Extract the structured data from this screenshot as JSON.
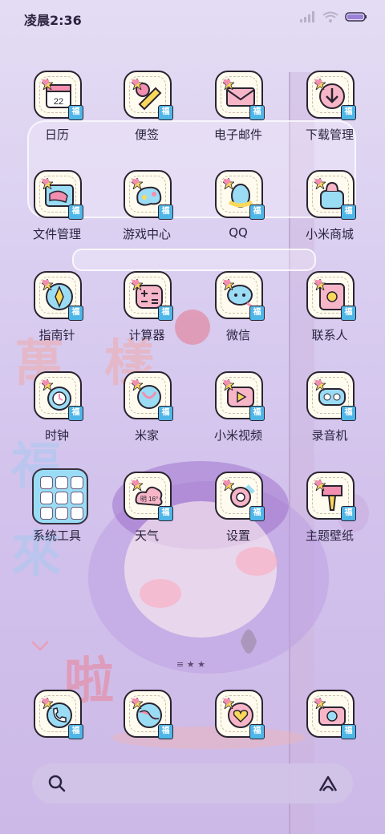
{
  "status_bar": {
    "time": "凌晨2:36"
  },
  "apps": [
    {
      "label": "日历",
      "icon": "calendar-icon",
      "day": "22"
    },
    {
      "label": "便签",
      "icon": "notes-pencil-icon"
    },
    {
      "label": "电子邮件",
      "icon": "email-envelope-icon"
    },
    {
      "label": "下载管理",
      "icon": "download-icon"
    },
    {
      "label": "文件管理",
      "icon": "file-manager-icon"
    },
    {
      "label": "游戏中心",
      "icon": "game-center-icon"
    },
    {
      "label": "QQ",
      "icon": "qq-penguin-icon"
    },
    {
      "label": "小米商城",
      "icon": "shopping-bag-icon"
    },
    {
      "label": "指南针",
      "icon": "compass-icon"
    },
    {
      "label": "计算器",
      "icon": "calculator-icon"
    },
    {
      "label": "微信",
      "icon": "wechat-icon"
    },
    {
      "label": "联系人",
      "icon": "contacts-icon"
    },
    {
      "label": "时钟",
      "icon": "alarm-clock-icon"
    },
    {
      "label": "米家",
      "icon": "mijia-icon"
    },
    {
      "label": "小米视频",
      "icon": "video-play-icon"
    },
    {
      "label": "录音机",
      "icon": "recorder-icon"
    },
    {
      "label": "系统工具",
      "icon": "folder-icon"
    },
    {
      "label": "天气",
      "icon": "weather-cloud-icon",
      "weather_text": "明 16°"
    },
    {
      "label": "设置",
      "icon": "settings-gear-icon"
    },
    {
      "label": "主题壁纸",
      "icon": "theme-brush-icon"
    }
  ],
  "badge_text": "福",
  "dock": [
    {
      "icon": "phone-icon"
    },
    {
      "icon": "browser-globe-icon"
    },
    {
      "icon": "gallery-heart-icon"
    },
    {
      "icon": "camera-icon"
    }
  ],
  "page_indicator": "≡ ★ ★",
  "search": {
    "left_icon": "search-icon",
    "right_icon": "assistant-icon"
  },
  "colors": {
    "tile": "#fffbef",
    "badge": "#4fb6e8",
    "accent_pink": "#f28fb0",
    "accent_yellow": "#f9d85b",
    "accent_blue": "#9bdcf5"
  }
}
